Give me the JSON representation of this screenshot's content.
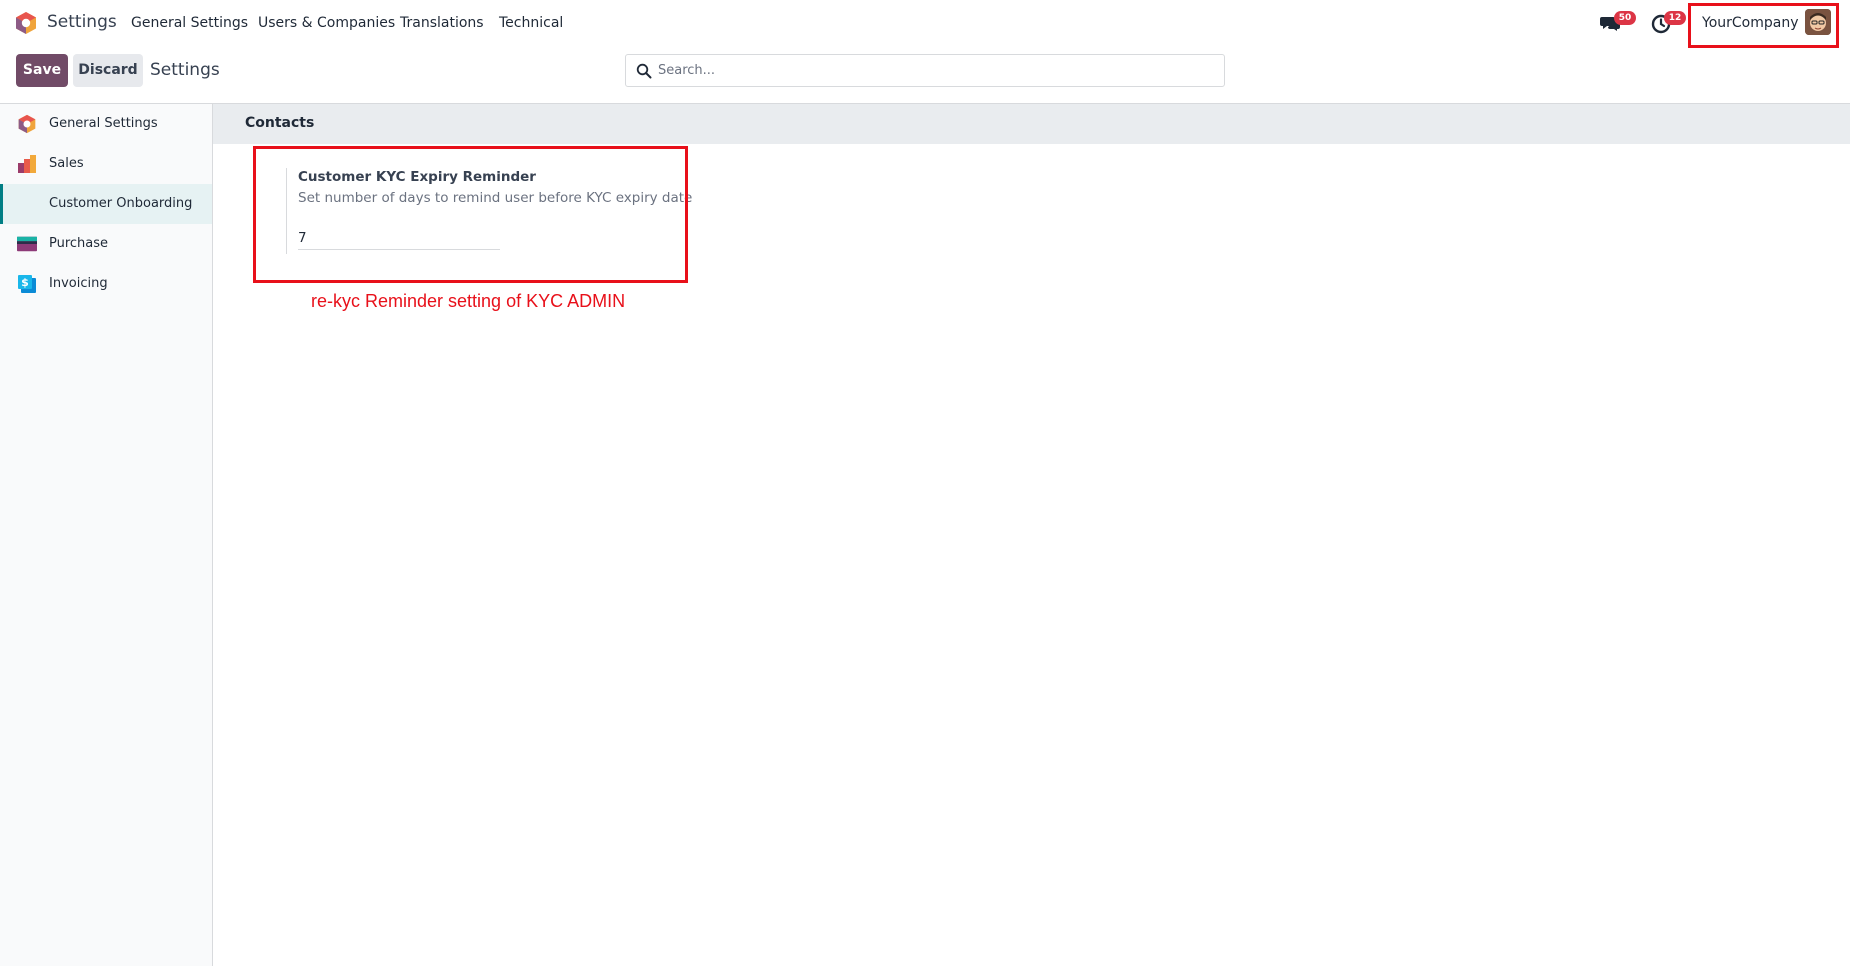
{
  "navbar": {
    "app_name": "Settings",
    "menus": [
      "General Settings",
      "Users & Companies",
      "Translations",
      "Technical"
    ],
    "messages_count": "50",
    "activities_count": "12",
    "company": "YourCompany"
  },
  "control_panel": {
    "save_label": "Save",
    "discard_label": "Discard",
    "title": "Settings",
    "search_placeholder": "Search..."
  },
  "sidebar": {
    "items": [
      {
        "label": "General Settings",
        "icon": "odoo-logo-icon"
      },
      {
        "label": "Sales",
        "icon": "sales-chart-icon"
      },
      {
        "label": "Customer Onboarding",
        "icon": "",
        "active": true
      },
      {
        "label": "Purchase",
        "icon": "purchase-card-icon"
      },
      {
        "label": "Invoicing",
        "icon": "invoice-dollar-icon"
      }
    ]
  },
  "content": {
    "section_title": "Contacts",
    "setting_title": "Customer KYC Expiry Reminder",
    "setting_desc": "Set number of days to remind user before KYC expiry date",
    "setting_value": "7",
    "annotation": "re-kyc Reminder setting of KYC ADMIN"
  },
  "colors": {
    "brand": "#714b67",
    "accent": "#017e84",
    "highlight": "#e8101a",
    "badge": "#dc3545"
  }
}
